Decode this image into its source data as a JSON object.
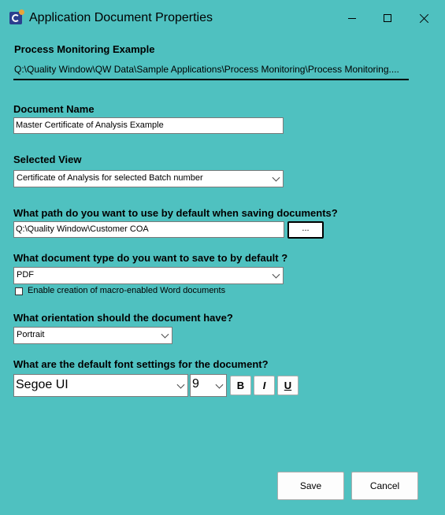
{
  "window": {
    "title": "Application Document Properties",
    "icon": "app-icon",
    "controls": {
      "minimize": "minimize-icon",
      "maximize": "maximize-icon",
      "close": "close-icon"
    }
  },
  "header": {
    "app_name": "Process Monitoring Example",
    "path": "Q:\\Quality Window\\QW Data\\Sample Applications\\Process Monitoring\\Process Monitoring...."
  },
  "document_name": {
    "label": "Document Name",
    "value": "Master Certificate of Analysis Example"
  },
  "selected_view": {
    "label": "Selected View",
    "value": "Certificate of Analysis for selected Batch number"
  },
  "save_path": {
    "label": "What path do you want to use by default when saving documents?",
    "value": "Q:\\Quality Window\\Customer COA",
    "browse_label": "..."
  },
  "document_type": {
    "label": "What document type do you want to save to by default ?",
    "value": "PDF",
    "macro_checkbox_label": "Enable creation of macro-enabled Word documents",
    "macro_checked": false
  },
  "orientation": {
    "label": "What orientation should the document have?",
    "value": "Portrait"
  },
  "font_settings": {
    "label": "What are the default font settings for the document?",
    "font_family": "Segoe UI",
    "font_size": "9",
    "bold_label": "B",
    "italic_label": "I",
    "underline_label": "U"
  },
  "buttons": {
    "save_label": "Save",
    "cancel_label": "Cancel"
  },
  "colors": {
    "background": "#4fc1c0"
  }
}
